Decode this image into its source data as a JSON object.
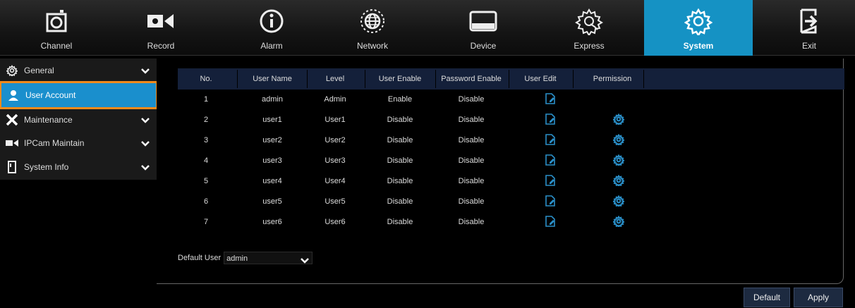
{
  "topnav": {
    "items": [
      {
        "label": "Channel",
        "icon": "camera-icon"
      },
      {
        "label": "Record",
        "icon": "video-camera-icon"
      },
      {
        "label": "Alarm",
        "icon": "info-icon"
      },
      {
        "label": "Network",
        "icon": "globe-icon"
      },
      {
        "label": "Device",
        "icon": "hard-drive-icon"
      },
      {
        "label": "Express",
        "icon": "gear-hand-icon"
      },
      {
        "label": "System",
        "icon": "gear-icon",
        "active": true
      },
      {
        "label": "Exit",
        "icon": "exit-icon"
      }
    ]
  },
  "sidebar": {
    "items": [
      {
        "label": "General",
        "icon": "gear-icon",
        "expandable": true
      },
      {
        "label": "User Account",
        "icon": "user-icon",
        "active": true
      },
      {
        "label": "Maintenance",
        "icon": "wrench-icon",
        "expandable": true
      },
      {
        "label": "IPCam Maintain",
        "icon": "ip-camera-icon",
        "expandable": true
      },
      {
        "label": "System Info",
        "icon": "info-card-icon",
        "expandable": true
      }
    ]
  },
  "table": {
    "headers": [
      "No.",
      "User Name",
      "Level",
      "User Enable",
      "Password Enable",
      "User Edit",
      "Permission"
    ],
    "rows": [
      {
        "no": "1",
        "user_name": "admin",
        "level": "Admin",
        "user_enable": "Enable",
        "password_enable": "Disable",
        "permission": false
      },
      {
        "no": "2",
        "user_name": "user1",
        "level": "User1",
        "user_enable": "Disable",
        "password_enable": "Disable",
        "permission": true
      },
      {
        "no": "3",
        "user_name": "user2",
        "level": "User2",
        "user_enable": "Disable",
        "password_enable": "Disable",
        "permission": true
      },
      {
        "no": "4",
        "user_name": "user3",
        "level": "User3",
        "user_enable": "Disable",
        "password_enable": "Disable",
        "permission": true
      },
      {
        "no": "5",
        "user_name": "user4",
        "level": "User4",
        "user_enable": "Disable",
        "password_enable": "Disable",
        "permission": true
      },
      {
        "no": "6",
        "user_name": "user5",
        "level": "User5",
        "user_enable": "Disable",
        "password_enable": "Disable",
        "permission": true
      },
      {
        "no": "7",
        "user_name": "user6",
        "level": "User6",
        "user_enable": "Disable",
        "password_enable": "Disable",
        "permission": true
      }
    ]
  },
  "default_user": {
    "label": "Default User",
    "value": "admin"
  },
  "buttons": {
    "default_label": "Default",
    "apply_label": "Apply"
  },
  "colors": {
    "accent": "#1592c4",
    "highlight_outline": "#f08a1c",
    "icon_blue": "#2a8fc8"
  }
}
